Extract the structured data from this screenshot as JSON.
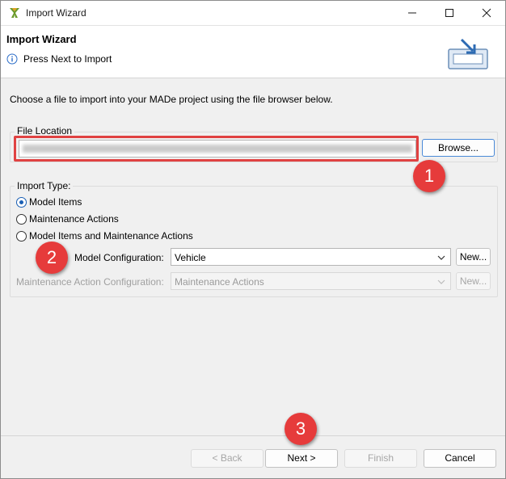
{
  "window": {
    "title": "Import Wizard"
  },
  "header": {
    "title": "Import Wizard",
    "message": "Press Next to Import"
  },
  "description": "Choose a file to import into your MADe project using the file browser below.",
  "file_location": {
    "label": "File Location",
    "value": "",
    "browse_label": "Browse..."
  },
  "import_type": {
    "label": "Import Type:",
    "options": [
      {
        "label": "Model Items",
        "checked": true
      },
      {
        "label": "Maintenance Actions",
        "checked": false
      },
      {
        "label": "Model Items and Maintenance Actions",
        "checked": false
      }
    ],
    "model_config": {
      "label": "Model Configuration:",
      "value": "Vehicle",
      "new_label": "New..."
    },
    "maintenance_config": {
      "label": "Maintenance Action Configuration:",
      "value": "Maintenance Actions",
      "new_label": "New..."
    }
  },
  "annotations": [
    "1",
    "2",
    "3"
  ],
  "footer": {
    "back_label": "< Back",
    "next_label": "Next >",
    "finish_label": "Finish",
    "cancel_label": "Cancel"
  },
  "colors": {
    "annotation_red": "#e63b3b",
    "primary_border": "#1e6fd9",
    "radio_accent": "#1a5fb4"
  }
}
